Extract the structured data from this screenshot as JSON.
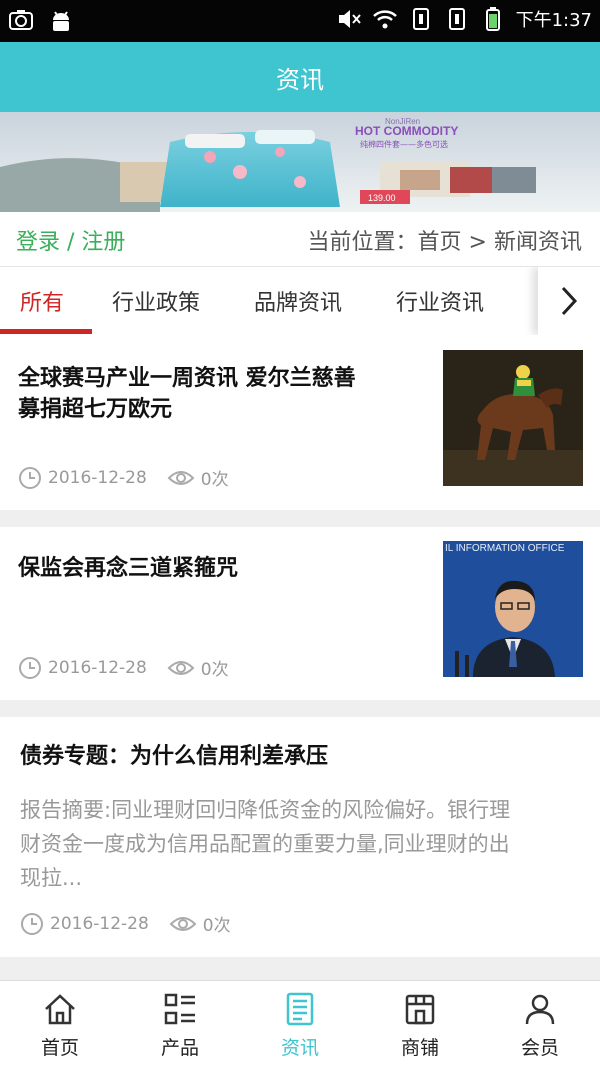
{
  "status_bar": {
    "time": "下午1:37",
    "icons": [
      "screenshot-icon",
      "android-icon",
      "mute-icon",
      "wifi-icon",
      "sim1-icon",
      "sim2-icon",
      "battery-icon"
    ]
  },
  "header": {
    "title": "资讯"
  },
  "banner": {
    "brand": "NonJiRen",
    "headline": "HOT COMMODITY",
    "subline": "纯棉四件套——多色可选",
    "price": "139.00"
  },
  "crumbs": {
    "login": "登录",
    "separator": " / ",
    "register": "注册",
    "position_label": "当前位置：",
    "home": "首页",
    "arrow": " > ",
    "current": "新闻资讯"
  },
  "tabs": {
    "items": [
      "所有",
      "行业政策",
      "品牌资讯",
      "行业资讯"
    ],
    "active_index": 0
  },
  "articles": [
    {
      "title_line1": "全球赛马产业一周资讯 爱尔兰慈善",
      "title_line2": "募捐超七万欧元",
      "date": "2016-12-28",
      "views": "0次",
      "thumb": "horse-racing-photo"
    },
    {
      "title_line1": "保监会再念三道紧箍咒",
      "date": "2016-12-28",
      "views": "0次",
      "thumb": "press-conference-photo",
      "thumb_text": "IL INFORMATION OFFICE"
    },
    {
      "title_line1": "债券专题：为什么信用利差承压",
      "summary_line1": "报告摘要:同业理财回归降低资金的风险偏好。银行理",
      "summary_line2": "财资金一度成为信用品配置的重要力量,同业理财的出",
      "summary_line3": "现拉...",
      "date": "2016-12-28",
      "views": "0次"
    }
  ],
  "bottom_nav": {
    "items": [
      {
        "label": "首页",
        "icon": "home-icon"
      },
      {
        "label": "产品",
        "icon": "grid-list-icon"
      },
      {
        "label": "资讯",
        "icon": "news-icon"
      },
      {
        "label": "商铺",
        "icon": "shop-icon"
      },
      {
        "label": "会员",
        "icon": "user-icon"
      }
    ],
    "active_index": 2
  },
  "colors": {
    "accent": "#3ec5d0",
    "active_tab": "#d02525",
    "login_green": "#3aae5a",
    "meta_gray": "#999999"
  }
}
